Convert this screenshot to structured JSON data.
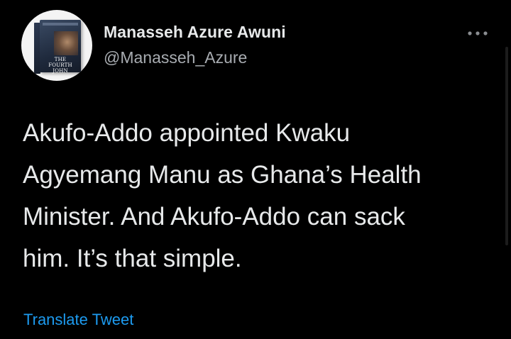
{
  "author": {
    "name": "Manasseh Azure Awuni",
    "handle": "@Manasseh_Azure",
    "avatar_book_title": "THE FOURTH JOHN",
    "avatar_icon": "book-cover-avatar"
  },
  "more_menu": {
    "icon": "more-dots-icon"
  },
  "tweet": {
    "lines": [
      "Akufo-Addo appointed Kwaku",
      "Agyemang Manu as Ghana’s Health",
      "Minister. And Akufo-Addo can sack",
      "him. It’s that simple."
    ]
  },
  "translate_label": "Translate Tweet",
  "colors": {
    "background": "#000000",
    "text_primary": "#e7e9ea",
    "text_secondary": "#a8acb1",
    "link": "#1d9bf0"
  }
}
